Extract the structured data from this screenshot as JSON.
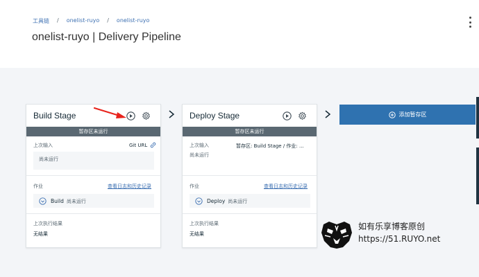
{
  "breadcrumb": [
    "工具链",
    "onelist-ruyo",
    "onelist-ruyo"
  ],
  "page": {
    "title": "onelist-ruyo | Delivery Pipeline"
  },
  "stages": [
    {
      "name": "Build Stage",
      "status": "暂存区未运行",
      "input_label": "上次输入",
      "input_source": "Git URL",
      "input_value": "尚未运行",
      "jobs_label": "作业",
      "jobs_link": "查看日志和历史记录",
      "job_name": "Build",
      "job_status": "尚未运行",
      "result_label": "上次执行结果",
      "result_value": "无结果"
    },
    {
      "name": "Deploy Stage",
      "status": "暂存区未运行",
      "input_label": "上次输入",
      "input_source": "暂存区: Build Stage / 作业: ...",
      "input_value": "尚未运行",
      "jobs_label": "作业",
      "jobs_link": "查看日志和历史记录",
      "job_name": "Deploy",
      "job_status": "尚未运行",
      "result_label": "上次执行结果",
      "result_value": "无结果"
    }
  ],
  "add_stage": {
    "label": "添加暂存区"
  },
  "watermark": {
    "line1": "如有乐享博客原创",
    "line2": "https://51.RUYO.net"
  },
  "colors": {
    "accent": "#2f72b0",
    "status_bar": "#5a6872",
    "link": "#3d70b2",
    "arrow": "#e8231c"
  },
  "icons": [
    "play-icon",
    "gear-icon",
    "chevron-right-icon",
    "plus-circle-icon",
    "link-icon",
    "job-expand-icon",
    "kebab-menu-icon",
    "tiger-logo-icon"
  ]
}
